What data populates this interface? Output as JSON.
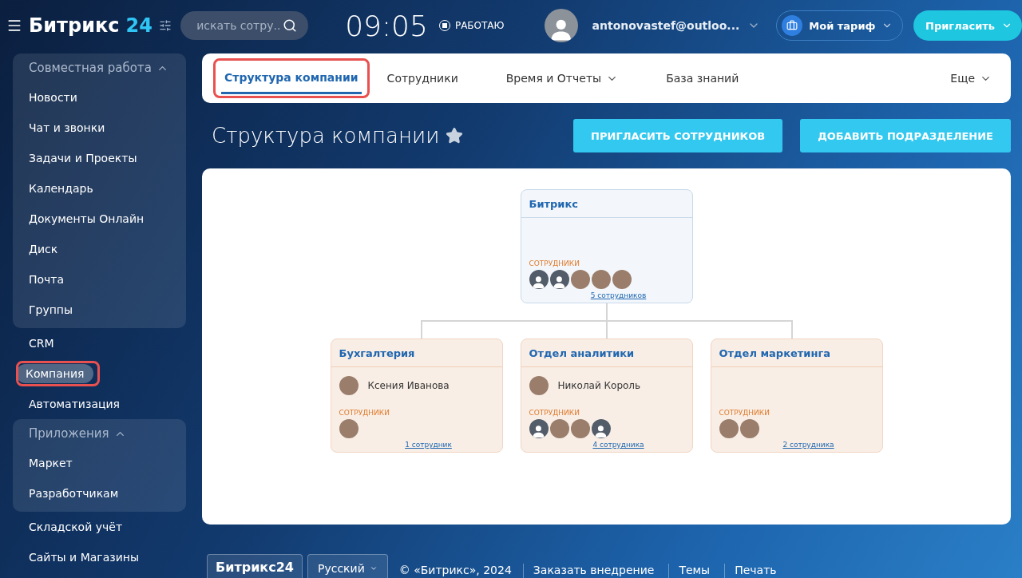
{
  "header": {
    "logo_text": "Битрикс",
    "logo_number": "24",
    "search": {
      "placeholder": "искать сотру..."
    },
    "clock": "09:05",
    "work_status": "РАБОТАЮ",
    "user": "antonovastef@outloo...",
    "tariff_button": "Мой тариф",
    "invite_button": "Пригласить"
  },
  "sidebar": {
    "items": [
      {
        "kind": "group",
        "label": "Совместная работа",
        "expanded": true,
        "children": [
          {
            "label": "Новости",
            "selected": false
          },
          {
            "label": "Чат и звонки",
            "selected": false
          },
          {
            "label": "Задачи и Проекты",
            "selected": false
          },
          {
            "label": "Календарь",
            "selected": false
          },
          {
            "label": "Документы Онлайн",
            "selected": false
          },
          {
            "label": "Диск",
            "selected": false
          },
          {
            "label": "Почта",
            "selected": false
          },
          {
            "label": "Группы",
            "selected": false
          }
        ]
      },
      {
        "kind": "item",
        "label": "CRM",
        "selected": false,
        "annotated": false
      },
      {
        "kind": "item",
        "label": "Компания",
        "selected": true,
        "annotated": true
      },
      {
        "kind": "item",
        "label": "Автоматизация",
        "selected": false,
        "annotated": false
      },
      {
        "kind": "group",
        "label": "Приложения",
        "expanded": true,
        "children": [
          {
            "label": "Маркет",
            "selected": false
          },
          {
            "label": "Разработчикам",
            "selected": false
          }
        ]
      },
      {
        "kind": "item",
        "label": "Складской учёт",
        "selected": false,
        "annotated": false
      },
      {
        "kind": "item",
        "label": "Сайты и Магазины",
        "selected": false,
        "annotated": false
      }
    ]
  },
  "tabs": [
    {
      "label": "Структура компании",
      "selected": true,
      "annotated": true,
      "dropdown": false
    },
    {
      "label": "Сотрудники",
      "selected": false,
      "annotated": false,
      "dropdown": false
    },
    {
      "label": "Время и Отчеты",
      "selected": false,
      "annotated": false,
      "dropdown": true
    },
    {
      "label": "База знаний",
      "selected": false,
      "annotated": false,
      "dropdown": false
    }
  ],
  "more_tab": "Еще",
  "page_title": "Структура компании",
  "favorite": true,
  "actions": [
    "ПРИГЛАСИТЬ СОТРУДНИКОВ",
    "ДОБАВИТЬ ПОДРАЗДЕЛЕНИЕ"
  ],
  "org_chart": {
    "root": {
      "name": "Битрикс",
      "employees_label": "СОТРУДНИКИ",
      "employees": [
        {
          "kind": "default"
        },
        {
          "kind": "default"
        },
        {
          "kind": "photo"
        },
        {
          "kind": "photo"
        },
        {
          "kind": "photo"
        }
      ],
      "count_link": "5 сотрудников"
    },
    "departments": [
      {
        "name": "Бухгалтерия",
        "head": {
          "name": "Ксения Иванова",
          "kind": "photo"
        },
        "employees_label": "СОТРУДНИКИ",
        "employees": [
          {
            "kind": "photo"
          }
        ],
        "count_link": "1 сотрудник"
      },
      {
        "name": "Отдел аналитики",
        "head": {
          "name": "Николай Король",
          "kind": "photo"
        },
        "employees_label": "СОТРУДНИКИ",
        "employees": [
          {
            "kind": "default"
          },
          {
            "kind": "photo"
          },
          {
            "kind": "photo"
          },
          {
            "kind": "default"
          }
        ],
        "count_link": "4 сотрудника"
      },
      {
        "name": "Отдел маркетинга",
        "employees_label": "СОТРУДНИКИ",
        "employees": [
          {
            "kind": "photo"
          },
          {
            "kind": "photo"
          }
        ],
        "count_link": "2 сотрудника"
      }
    ]
  },
  "footer": {
    "logo_text": "Битрикс24",
    "language": "Русский",
    "copyright": "© «Битрикс», 2024",
    "links": [
      "Заказать внедрение",
      "Темы",
      "Печать"
    ]
  }
}
